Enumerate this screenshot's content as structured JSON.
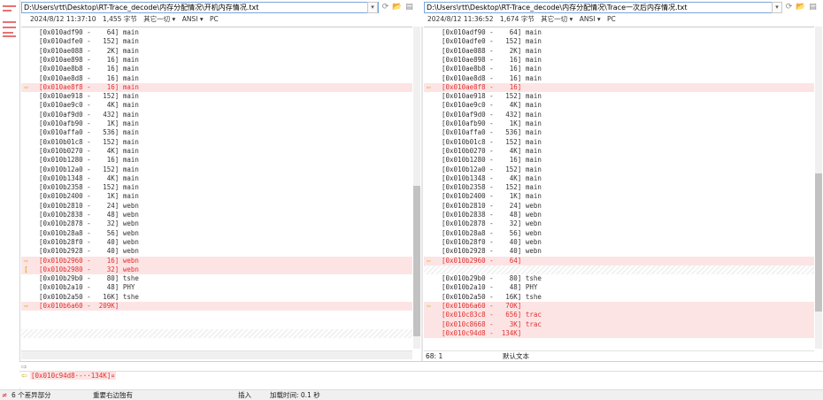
{
  "left_panel": {
    "path": "D:\\Users\\rtt\\Desktop\\RT-Trace_decode\\内存分配情况\\开机内存情况.txt",
    "info": {
      "datetime": "2024/8/12 11:37:10",
      "size": "1,455 字节",
      "encoding_other": "其它一切 ▾",
      "encoding": "ANSI ▾",
      "line_ending": "PC"
    },
    "lines": [
      {
        "text": "[0x010adf90 -    64] main",
        "type": "normal"
      },
      {
        "text": "[0x010adfe0 -   152] main",
        "type": "normal"
      },
      {
        "text": "[0x010ae088 -    2K] main",
        "type": "normal"
      },
      {
        "text": "[0x010ae898 -    16] main",
        "type": "normal"
      },
      {
        "text": "[0x010ae8b8 -    16] main",
        "type": "normal"
      },
      {
        "text": "[0x010ae8d8 -    16] main",
        "type": "normal"
      },
      {
        "text": "[0x010ae8f8 -    16] main",
        "type": "diff",
        "marker": "⇨"
      },
      {
        "text": "[0x010ae918 -   152] main",
        "type": "normal"
      },
      {
        "text": "[0x010ae9c0 -    4K] main",
        "type": "normal"
      },
      {
        "text": "[0x010af9d0 -   432] main",
        "type": "normal"
      },
      {
        "text": "[0x010afb90 -    1K] main",
        "type": "normal"
      },
      {
        "text": "[0x010affa0 -   536] main",
        "type": "normal"
      },
      {
        "text": "[0x010b01c8 -   152] main",
        "type": "normal"
      },
      {
        "text": "[0x010b0270 -    4K] main",
        "type": "normal"
      },
      {
        "text": "[0x010b1280 -    16] main",
        "type": "normal"
      },
      {
        "text": "[0x010b12a0 -   152] main",
        "type": "normal"
      },
      {
        "text": "[0x010b1348 -    4K] main",
        "type": "normal"
      },
      {
        "text": "[0x010b2358 -   152] main",
        "type": "normal"
      },
      {
        "text": "[0x010b2400 -    1K] main",
        "type": "normal"
      },
      {
        "text": "[0x010b2810 -    24] webn",
        "type": "normal"
      },
      {
        "text": "[0x010b2838 -    48] webn",
        "type": "normal"
      },
      {
        "text": "[0x010b2878 -    32] webn",
        "type": "normal"
      },
      {
        "text": "[0x010b28a8 -    56] webn",
        "type": "normal"
      },
      {
        "text": "[0x010b28f0 -    40] webn",
        "type": "normal"
      },
      {
        "text": "[0x010b2928 -    40] webn",
        "type": "normal"
      },
      {
        "text": "[0x010b2960 -    16] webn",
        "type": "diff",
        "marker": "⇨"
      },
      {
        "text": "[0x010b2980 -    32] webn",
        "type": "diff",
        "marker": "["
      },
      {
        "text": "[0x010b29b0 -    80] tshe",
        "type": "normal"
      },
      {
        "text": "[0x010b2a10 -    48] PHY",
        "type": "normal"
      },
      {
        "text": "[0x010b2a50 -   16K] tshe",
        "type": "normal"
      },
      {
        "text": "[0x010b6a60 -  209K]",
        "type": "diff",
        "marker": "⇨"
      },
      {
        "text": "",
        "type": "normal"
      },
      {
        "text": "",
        "type": "normal"
      },
      {
        "text": "",
        "type": "hatch"
      },
      {
        "text": "",
        "type": "normal"
      }
    ]
  },
  "right_panel": {
    "path": "D:\\Users\\rtt\\Desktop\\RT-Trace_decode\\内存分配情况\\Trace一次后内存情况.txt",
    "info": {
      "datetime": "2024/8/12 11:36:52",
      "size": "1,674 字节",
      "encoding_other": "其它一切 ▾",
      "encoding": "ANSI ▾",
      "line_ending": "PC"
    },
    "lines": [
      {
        "text": "[0x010adf90 -    64] main",
        "type": "normal"
      },
      {
        "text": "[0x010adfe0 -   152] main",
        "type": "normal"
      },
      {
        "text": "[0x010ae088 -    2K] main",
        "type": "normal"
      },
      {
        "text": "[0x010ae898 -    16] main",
        "type": "normal"
      },
      {
        "text": "[0x010ae8b8 -    16] main",
        "type": "normal"
      },
      {
        "text": "[0x010ae8d8 -    16] main",
        "type": "normal"
      },
      {
        "text": "[0x010ae8f8 -    16]",
        "type": "diff",
        "marker": "⇦"
      },
      {
        "text": "[0x010ae918 -   152] main",
        "type": "normal"
      },
      {
        "text": "[0x010ae9c0 -    4K] main",
        "type": "normal"
      },
      {
        "text": "[0x010af9d0 -   432] main",
        "type": "normal"
      },
      {
        "text": "[0x010afb90 -    1K] main",
        "type": "normal"
      },
      {
        "text": "[0x010affa0 -   536] main",
        "type": "normal"
      },
      {
        "text": "[0x010b01c8 -   152] main",
        "type": "normal"
      },
      {
        "text": "[0x010b0270 -    4K] main",
        "type": "normal"
      },
      {
        "text": "[0x010b1280 -    16] main",
        "type": "normal"
      },
      {
        "text": "[0x010b12a0 -   152] main",
        "type": "normal"
      },
      {
        "text": "[0x010b1348 -    4K] main",
        "type": "normal"
      },
      {
        "text": "[0x010b2358 -   152] main",
        "type": "normal"
      },
      {
        "text": "[0x010b2400 -    1K] main",
        "type": "normal"
      },
      {
        "text": "[0x010b2810 -    24] webn",
        "type": "normal"
      },
      {
        "text": "[0x010b2838 -    48] webn",
        "type": "normal"
      },
      {
        "text": "[0x010b2878 -    32] webn",
        "type": "normal"
      },
      {
        "text": "[0x010b28a8 -    56] webn",
        "type": "normal"
      },
      {
        "text": "[0x010b28f0 -    40] webn",
        "type": "normal"
      },
      {
        "text": "[0x010b2928 -    40] webn",
        "type": "normal"
      },
      {
        "text": "[0x010b2960 -    64]",
        "type": "diff",
        "marker": "⇦"
      },
      {
        "text": "",
        "type": "hatch"
      },
      {
        "text": "[0x010b29b0 -    80] tshe",
        "type": "normal"
      },
      {
        "text": "[0x010b2a10 -    48] PHY",
        "type": "normal"
      },
      {
        "text": "[0x010b2a50 -   16K] tshe",
        "type": "normal"
      },
      {
        "text": "[0x010b6a60 -   70K]",
        "type": "diff",
        "marker": "⇦"
      },
      {
        "text": "[0x010c83c8 -   656] trac",
        "type": "diff"
      },
      {
        "text": "[0x010c8668 -    3K] trac",
        "type": "diff"
      },
      {
        "text": "[0x010c94d8 -  134K]",
        "type": "diff"
      },
      {
        "text": "",
        "type": "normal"
      }
    ],
    "cursor": "68: 1",
    "mode": "默认文本"
  },
  "detail": {
    "top_line": "",
    "bottom_line": "[0x010c94d8·-··134K]¤"
  },
  "status": {
    "diff_count": "6 个差异部分",
    "summary": "重要右边独有",
    "insert_mode": "插入",
    "load_time": "加载时间: 0.1 秒"
  },
  "colors": {
    "diff_bg": "#fde4e4",
    "diff_text": "#e03030",
    "marker": "#c9a400"
  }
}
